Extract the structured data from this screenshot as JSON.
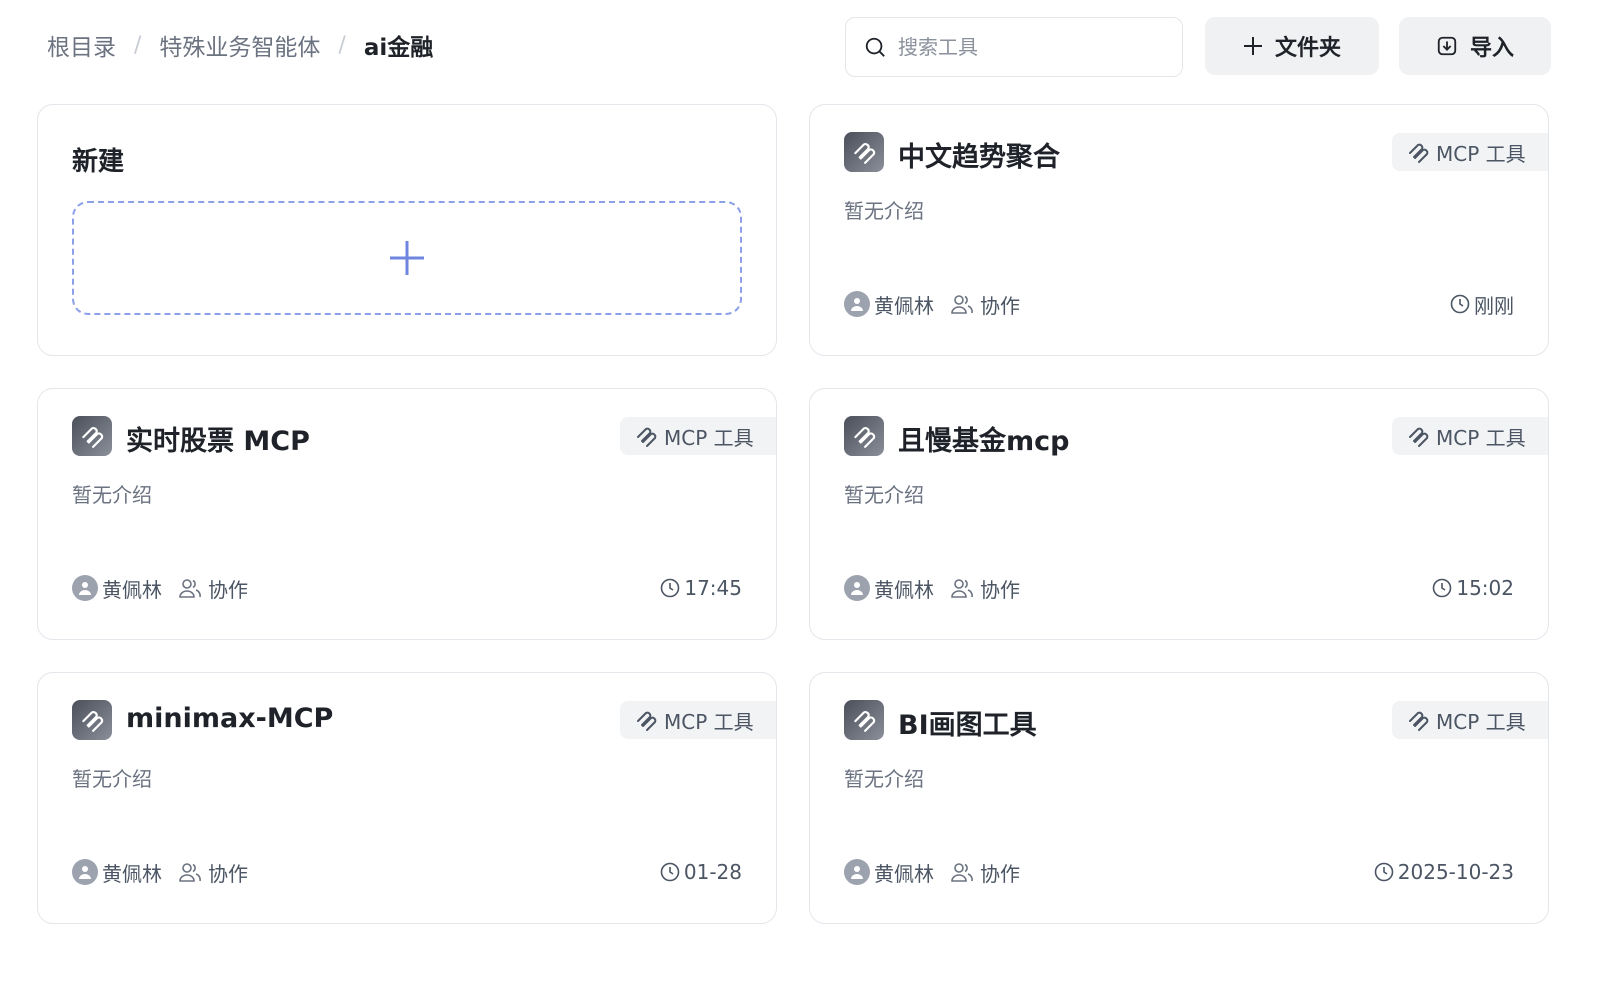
{
  "breadcrumb": {
    "items": [
      "根目录",
      "特殊业务智能体",
      "ai金融"
    ],
    "separator": "/"
  },
  "search": {
    "placeholder": "搜索工具",
    "value": ""
  },
  "toolbar": {
    "folder_label": "文件夹",
    "import_label": "导入"
  },
  "new_card": {
    "title": "新建"
  },
  "tools": [
    {
      "name": "中文趋势聚合",
      "tag": "MCP 工具",
      "description": "暂无介绍",
      "owner": "黄佩林",
      "collab": "协作",
      "time": "刚刚"
    },
    {
      "name": "实时股票 MCP",
      "tag": "MCP 工具",
      "description": "暂无介绍",
      "owner": "黄佩林",
      "collab": "协作",
      "time": "17:45"
    },
    {
      "name": "且慢基金mcp",
      "tag": "MCP 工具",
      "description": "暂无介绍",
      "owner": "黄佩林",
      "collab": "协作",
      "time": "15:02"
    },
    {
      "name": "minimax-MCP",
      "tag": "MCP 工具",
      "description": "暂无介绍",
      "owner": "黄佩林",
      "collab": "协作",
      "time": "01-28"
    },
    {
      "name": "BI画图工具",
      "tag": "MCP 工具",
      "description": "暂无介绍",
      "owner": "黄佩林",
      "collab": "协作",
      "time": "2025-10-23"
    }
  ],
  "colors": {
    "accent_dashed": "#8ca0ea",
    "button_bg": "#f0f1f3",
    "border": "#e3e6eb"
  }
}
